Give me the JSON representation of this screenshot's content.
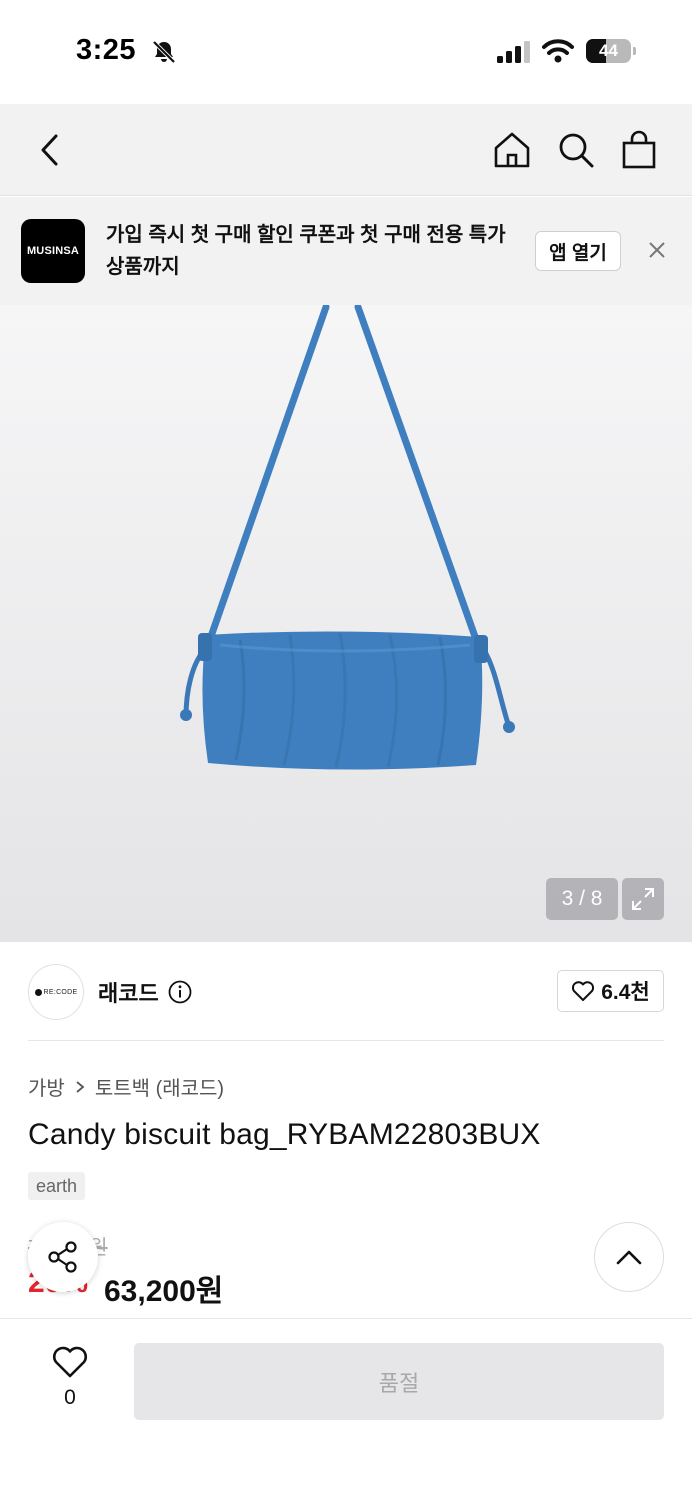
{
  "status_bar": {
    "time": "3:25",
    "battery_level": "44",
    "battery_fraction": 0.44,
    "icons": [
      "bell-slash-icon",
      "signal-icon",
      "wifi-icon",
      "battery-icon"
    ]
  },
  "nav": {
    "icons": [
      "back-icon",
      "home-icon",
      "search-icon",
      "bag-icon"
    ]
  },
  "banner": {
    "logo_text": "MUSINSA",
    "message": "가입 즉시 첫 구매 할인 쿠폰과 첫 구매 전용 특가 상품까지",
    "open_app_label": "앱 열기",
    "close_icon": "close-icon"
  },
  "gallery": {
    "page_indicator": "3 / 8",
    "current": 3,
    "total": 8,
    "bag_color": "#3f7fc0"
  },
  "brand": {
    "logo_text": "RE:CODE",
    "name": "래코드",
    "likes": "6.4천"
  },
  "product": {
    "breadcrumb": [
      "가방",
      "토트백 (래코드)"
    ],
    "title": "Candy biscuit bag_RYBAM22803BUX",
    "tag": "earth",
    "original_price": "79,000원",
    "discount": "20%",
    "sale_price": "63,200원"
  },
  "bottom": {
    "wish_count": "0",
    "soldout_label": "품절"
  },
  "colors": {
    "accent_red": "#e3262c",
    "bag_blue": "#3f7fc0"
  }
}
